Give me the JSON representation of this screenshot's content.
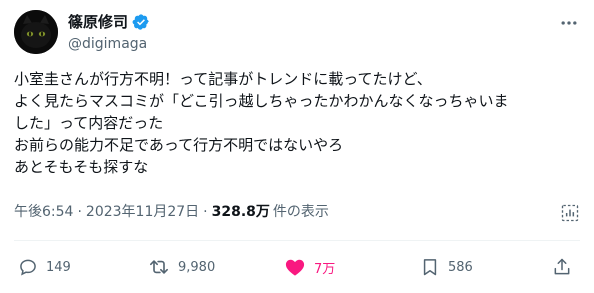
{
  "author": {
    "display_name": "篠原修司",
    "handle": "@digimaga",
    "verified": true,
    "avatar": "black-cat-avatar"
  },
  "tweet": {
    "lines": [
      "小室圭さんが行方不明！って記事がトレンドに載ってたけど、",
      "よく見たらマスコミが「どこ引っ越しちゃったかわかんなくなっちゃいま",
      "した」って内容だった",
      "お前らの能力不足であって行方不明ではないやろ",
      "あとそもそも探すな"
    ]
  },
  "meta": {
    "time": "午後6:54",
    "separator1": "·",
    "date": "2023年11月27日",
    "separator2": "·",
    "views_count": "328.8万",
    "views_label": "件の表示"
  },
  "actions": {
    "replies": "149",
    "reposts": "9,980",
    "likes": "7万",
    "bookmarks": "586"
  },
  "colors": {
    "like_active": "#f91880",
    "verified": "#1d9bf0",
    "secondary_text": "#536471"
  }
}
